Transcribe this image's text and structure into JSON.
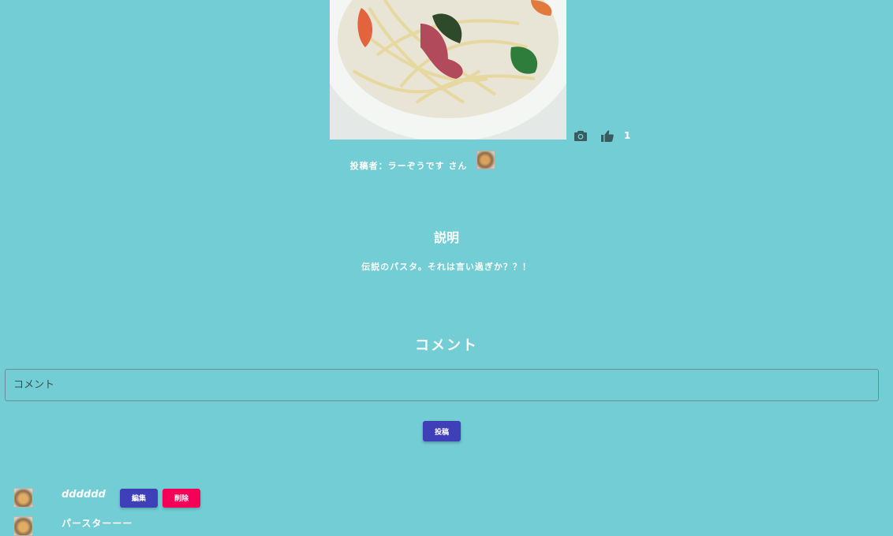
{
  "post": {
    "image_alt": "pasta dish photo",
    "author_text": "投稿者：ラーぞうです さん",
    "like_count": "1"
  },
  "icons": {
    "camera": "camera-icon",
    "like": "thumbs-up-icon"
  },
  "description": {
    "title": "説明",
    "text": "伝説のパスタ。それは言い過ぎか？？！"
  },
  "comments_section": {
    "title": "コメント",
    "input_placeholder": "コメント",
    "input_value": "",
    "submit_label": "投稿"
  },
  "comments": [
    {
      "text": "dddddd",
      "edit_label": "編集",
      "delete_label": "削除"
    },
    {
      "text": "パースターーー"
    }
  ],
  "colors": {
    "background": "#72cdd5",
    "primary": "#3f3fb8",
    "danger": "#f50057",
    "icon": "#3a5a5e"
  }
}
